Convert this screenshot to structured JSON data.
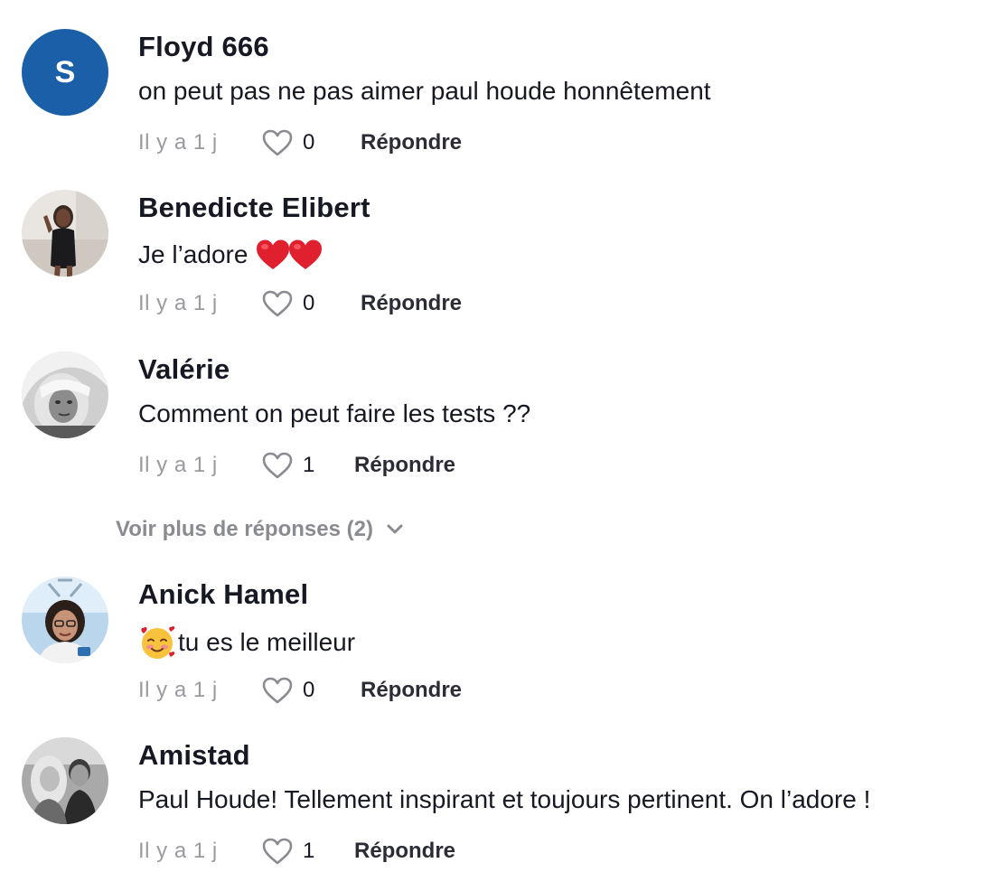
{
  "comments": [
    {
      "author": "Floyd 666",
      "avatar_letter": "S",
      "text": "on peut pas ne pas aimer paul houde honnêtement",
      "time": "Il y a 1 j",
      "likes": "0",
      "reply_label": "Répondre"
    },
    {
      "author": "Benedicte Elibert",
      "text": "Je l’adore",
      "emojis": [
        "heart-emoji",
        "heart-emoji"
      ],
      "time": "Il y a 1 j",
      "likes": "0",
      "reply_label": "Répondre"
    },
    {
      "author": "Valérie",
      "text": "Comment on peut faire les tests ??",
      "time": "Il y a 1 j",
      "likes": "1",
      "reply_label": "Répondre"
    },
    {
      "author": "Anick Hamel",
      "emoji": "smiling-face-with-hearts-emoji",
      "text": "tu es le meilleur",
      "time": "Il y a 1 j",
      "likes": "0",
      "reply_label": "Répondre"
    },
    {
      "author": "Amistad",
      "text": "Paul Houde! Tellement inspirant et toujours pertinent. On l’adore !",
      "time": "Il y a 1 j",
      "likes": "1",
      "reply_label": "Répondre"
    }
  ],
  "more_replies_label": "Voir plus de réponses (2)",
  "colors": {
    "text": "#161823",
    "muted": "#9a9ba0",
    "avatar_blue": "#1a5fa8",
    "heart_red": "#e0202e"
  },
  "icons": {
    "like": "heart-outline-icon",
    "expand": "chevron-down-icon"
  }
}
